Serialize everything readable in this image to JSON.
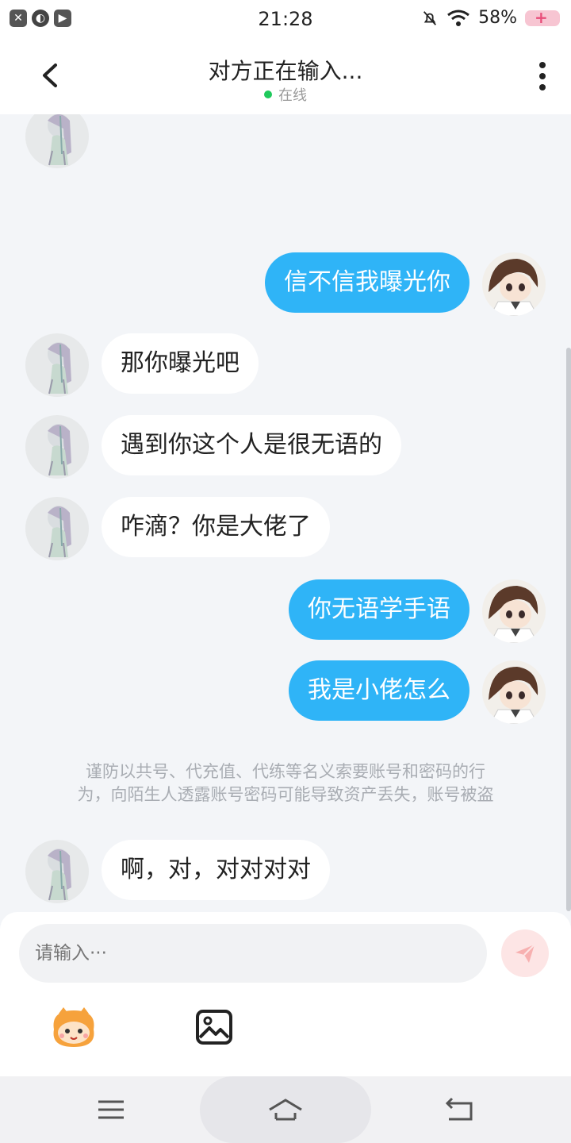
{
  "status_bar": {
    "time": "21:28",
    "battery": "58%"
  },
  "header": {
    "title": "对方正在输入...",
    "status": "在线"
  },
  "messages": [
    {
      "side": "in",
      "text": ""
    },
    {
      "side": "out",
      "text": "信不信我曝光你"
    },
    {
      "side": "in",
      "text": "那你曝光吧"
    },
    {
      "side": "in",
      "text": "遇到你这个人是很无语的"
    },
    {
      "side": "in",
      "text": "咋滴？你是大佬了"
    },
    {
      "side": "out",
      "text": "你无语学手语"
    },
    {
      "side": "out",
      "text": "我是小佬怎么"
    },
    {
      "side": "in",
      "text": "啊，对，对对对对"
    }
  ],
  "notice": {
    "line1": "谨防以共号、代充值、代练等名义索要账号和密码的行",
    "line2": "为，向陌生人透露账号密码可能导致资产丢失，账号被盗"
  },
  "composer": {
    "placeholder": "请输入···"
  },
  "colors": {
    "accent": "#2fb4f7",
    "online": "#1fc95c",
    "send_bg": "#fde5e5"
  },
  "icons": [
    "back-arrow-icon",
    "more-vertical-icon",
    "send-icon",
    "emoji-icon",
    "image-icon",
    "menu-icon",
    "home-icon",
    "back-nav-icon"
  ]
}
